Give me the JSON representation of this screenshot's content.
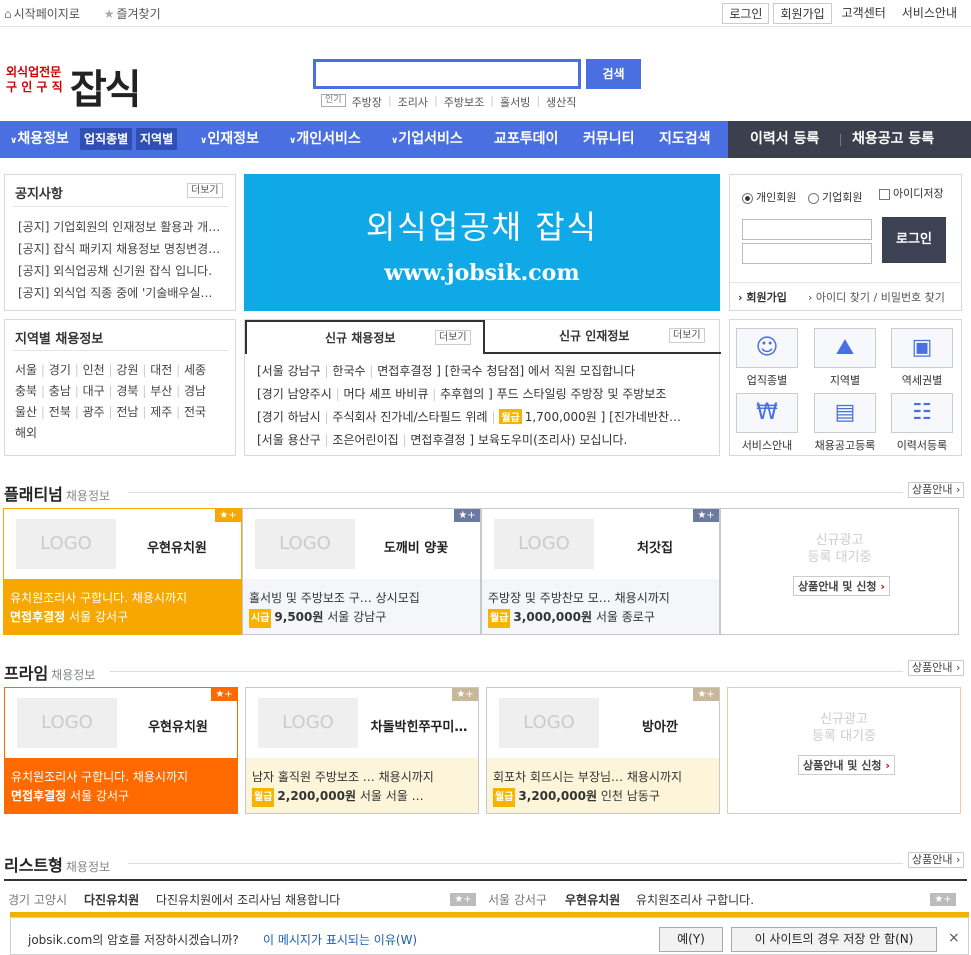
{
  "topbar": {
    "homepage": "시작페이지로",
    "favorites": "즐겨찾기",
    "links": [
      "로그인",
      "회원가입",
      "고객센터",
      "서비스안내"
    ]
  },
  "logo": {
    "small_line1": "외식업전문",
    "small_line2": "구 인 구 직",
    "big": "잡식"
  },
  "search": {
    "value": "",
    "button": "검색",
    "popular_tag": "인기",
    "keywords": [
      "주방장",
      "조리사",
      "주방보조",
      "홀서빙",
      "생산직"
    ]
  },
  "nav": {
    "items": [
      "채용정보",
      "인재정보",
      "개인서비스",
      "기업서비스",
      "교포투데이",
      "커뮤니티",
      "지도검색"
    ],
    "subs": [
      "업직종별",
      "지역별"
    ],
    "right": [
      "이력서 등록",
      "채용공고 등록"
    ]
  },
  "notice": {
    "title": "공지사항",
    "more": "더보기",
    "items": [
      "[공지] 기업회원의 인재정보 활용과 개…",
      "[공지] 잡식 패키지 채용정보 명칭변경…",
      "[공지] 외식업공채 신기원 잡식 입니다.",
      "[공지] 외식업 직종 중에 '기술배우실…"
    ]
  },
  "banner": {
    "line1": "외식업공채 잡식",
    "line2": "www.jobsik.com"
  },
  "login": {
    "personal": "개인회원",
    "company": "기업회원",
    "save_id": "아이디저장",
    "button": "로그인",
    "join": "회원가입",
    "find": "아이디 찾기 / 비밀번호 찾기"
  },
  "region": {
    "title": "지역별 채용정보",
    "rows": [
      [
        "서울",
        "경기",
        "인천",
        "강원",
        "대전",
        "세종"
      ],
      [
        "충북",
        "충남",
        "대구",
        "경북",
        "부산",
        "경남"
      ],
      [
        "울산",
        "전북",
        "광주",
        "전남",
        "제주",
        "전국"
      ],
      [
        "해외"
      ]
    ]
  },
  "newjobs": {
    "tab1": "신규 채용정보",
    "tab2": "신규 인재정보",
    "more": "더보기",
    "items": [
      {
        "loc": "[서울 강남구",
        "co": "한국수",
        "cond": "면접후결정",
        "rest": "] [한국수 청담점] 에서 직원 모집합니다"
      },
      {
        "loc": "[경기 남양주시",
        "co": "머다 셰프 바비큐",
        "cond": "추후협의",
        "rest": "] 푸드 스타일링 주방장 및 주방보조"
      },
      {
        "loc": "[경기 하남시",
        "co": "주식회사 진가네/스타필드 위례",
        "wage_tag": "월급",
        "cond": "1,700,000원",
        "rest": "] [진가네반찬…"
      },
      {
        "loc": "[서울 용산구",
        "co": "조은어린이집",
        "cond": "면접후결정",
        "rest": "] 보육도우미(조리사) 모십니다."
      }
    ]
  },
  "quick": [
    {
      "label": "업직종별",
      "icon": "person-icon"
    },
    {
      "label": "지역별",
      "icon": "map-icon"
    },
    {
      "label": "역세권별",
      "icon": "train-icon"
    },
    {
      "label": "서비스안내",
      "icon": "won-icon"
    },
    {
      "label": "채용공고등록",
      "icon": "document-icon"
    },
    {
      "label": "이력서등록",
      "icon": "resume-icon"
    }
  ],
  "platinum": {
    "title": "플래티넘",
    "sub": "채용정보",
    "prod": "상품안내",
    "cards": [
      {
        "logo": "LOGO",
        "name": "우현유치원",
        "line1": "유치원조리사 구합니다. 채용시까지",
        "tag": "면접후결정",
        "loc": "서울 강서구"
      },
      {
        "logo": "LOGO",
        "name": "도깨비 양꽃",
        "line1": "홀서빙 및 주방보조 구… 상시모집",
        "tag": "시급",
        "amount": "9,500원",
        "loc": "서울 강남구"
      },
      {
        "logo": "LOGO",
        "name": "처갓집",
        "line1": "주방장 및 주방찬모 모… 채용시까지",
        "tag": "월급",
        "amount": "3,000,000원",
        "loc": "서울 종로구"
      }
    ],
    "empty_line1": "신규광고",
    "empty_line2": "등록 대기중",
    "empty_btn": "상품안내 및 신청"
  },
  "prime": {
    "title": "프라임",
    "sub": "채용정보",
    "prod": "상품안내",
    "cards": [
      {
        "logo": "LOGO",
        "name": "우현유치원",
        "line1": "유치원조리사 구합니다. 채용시까지",
        "tag": "면접후결정",
        "loc": "서울 강서구"
      },
      {
        "logo": "LOGO",
        "name": "차돌박힌쭈꾸미…",
        "line1": "남자 홀직원 주방보조 … 채용시까지",
        "tag": "월급",
        "amount": "2,200,000원",
        "loc": "서울 서울 …"
      },
      {
        "logo": "LOGO",
        "name": "방아깐",
        "line1": "회포차 회뜨시는 부장님… 채용시까지",
        "tag": "월급",
        "amount": "3,200,000원",
        "loc": "인천 남동구"
      }
    ],
    "empty_line1": "신규광고",
    "empty_line2": "등록 대기중",
    "empty_btn": "상품안내 및 신청"
  },
  "listtype": {
    "title": "리스트형",
    "sub": "채용정보",
    "prod": "상품안내",
    "rows": [
      {
        "loc": "경기 고양시",
        "co": "다진유치원",
        "desc": "다진유치원에서 조리사님 채용합니다"
      },
      {
        "loc": "서울 강서구",
        "co": "우현유치원",
        "desc": "유치원조리사 구합니다."
      }
    ]
  },
  "pwbar": {
    "message": "jobsik.com의 암호를 저장하시겠습니까?",
    "why": "이 메시지가 표시되는 이유(W)",
    "yes": "예(Y)",
    "never": "이 사이트의 경우 저장 안 함(N)",
    "close": "×"
  },
  "colors": {
    "brand_blue": "#4a6fe0",
    "banner": "#10a9e8",
    "orange": "#f6a800",
    "prime_orange": "#ff6a00",
    "dark_nav": "#3c3f4d"
  }
}
